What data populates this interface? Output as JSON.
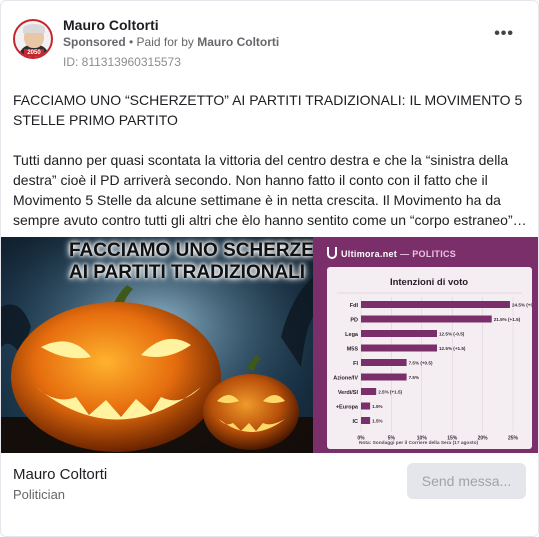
{
  "post": {
    "page_name": "Mauro Coltorti",
    "sponsored_label": "Sponsored",
    "paid_prefix": " • Paid for by ",
    "payer": "Mauro Coltorti",
    "ad_id": "ID: 811313960315573",
    "more_label": "•••",
    "avatar_badge": "2050"
  },
  "body": {
    "headline": "FACCIAMO UNO “SCHERZETTO” AI PARTITI TRADIZIONALI: IL MOVIMENTO 5 STELLE PRIMO PARTITO",
    "description": "Tutti danno per quasi scontata la vittoria del centro destra e che la “sinistra della destra” cioè il PD arriverà secondo. Non hanno fatto il conto con il fatto che il Movimento 5 Stelle da alcune settimane è in netta crescita. Il Movimento ha da sempre avuto contro tutti gli altri che èlo hanno sentito come un “corpo estraneo”…"
  },
  "image": {
    "title_line1": "FACCIAMO UNO SCHERZETTO",
    "title_line2": "AI PARTITI TRADIZIONALI",
    "brand": "Ultimora.net",
    "brand_section": "— POLITICS"
  },
  "chart_data": {
    "type": "bar",
    "title": "Intenzioni di voto",
    "categories": [
      "FdI",
      "PD",
      "Lega",
      "M5S",
      "FI",
      "Azione/IV",
      "Verdi/SI",
      "+Europa",
      "IC"
    ],
    "values": [
      24.5,
      21.5,
      12.5,
      12.5,
      7.5,
      7.5,
      2.5,
      1.5,
      1.5
    ],
    "labels": [
      "24.5% (+0.5)",
      "21.5% (+1.5)",
      "12.5% (-0.5)",
      "12.5% (+1.5)",
      "7.5% (+0.5)",
      "7.5%",
      "2.5% (+1.5)",
      "1.5%",
      "1.5%"
    ],
    "xticks": [
      "0%",
      "5%",
      "10%",
      "15%",
      "20%",
      "25%"
    ],
    "xlim": [
      0,
      25
    ],
    "grid": true,
    "footnote": "Nota: Sondaggi per il Corriere della Sera (17 agosto)",
    "bar_color": "#7a2f6a"
  },
  "footer": {
    "name": "Mauro Coltorti",
    "category": "Politician",
    "send_button": "Send messa..."
  },
  "colors": {
    "accent": "#7a2f6a",
    "secondary_text": "#65676b"
  }
}
